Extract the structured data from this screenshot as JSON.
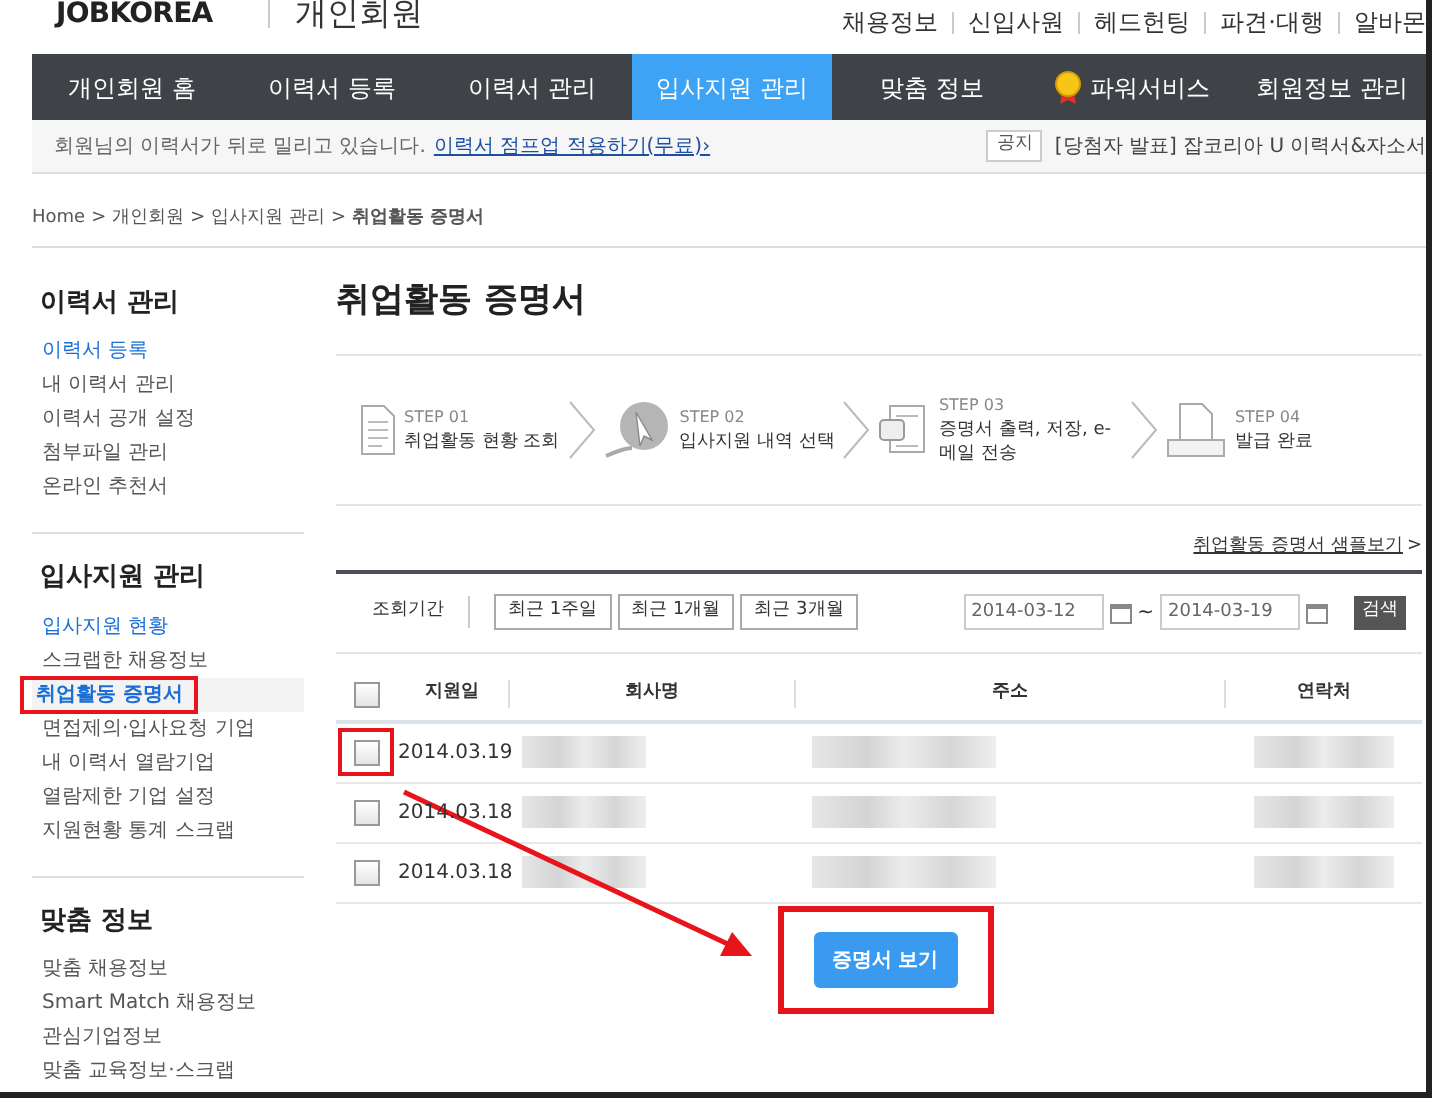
{
  "header": {
    "logo": "JOBKOREA",
    "section": "개인회원",
    "links": [
      "채용정보",
      "신입사원",
      "헤드헌팅",
      "파견·대행",
      "알바몬"
    ]
  },
  "nav": [
    {
      "label": "개인회원 홈",
      "selected": false,
      "kind": "text"
    },
    {
      "label": "이력서 등록",
      "selected": false,
      "kind": "text"
    },
    {
      "label": "이력서 관리",
      "selected": false,
      "kind": "text"
    },
    {
      "label": "입사지원 관리",
      "selected": true,
      "kind": "text"
    },
    {
      "label": "맞춤 정보",
      "selected": false,
      "kind": "text"
    },
    {
      "label": "파워서비스",
      "selected": false,
      "kind": "medal"
    },
    {
      "label": "회원정보 관리",
      "selected": false,
      "kind": "text"
    }
  ],
  "notice": {
    "message": "회원님의 이력서가 뒤로 밀리고 있습니다.",
    "link": "이력서 점프업 적용하기(무료)›",
    "tag": "공지",
    "headline": "[당첨자 발표] 잡코리아 U 이력서&자소서"
  },
  "breadcrumb": {
    "items": [
      "Home",
      "개인회원",
      "입사지원 관리",
      "취업활동 증명서"
    ],
    "separator": ">"
  },
  "sidebar": [
    {
      "title": "이력서 관리",
      "items": [
        {
          "label": "이력서 등록",
          "selected": false,
          "highlighted": true,
          "annotated": false
        },
        {
          "label": "내 이력서 관리",
          "selected": false,
          "highlighted": false,
          "annotated": false
        },
        {
          "label": "이력서 공개 설정",
          "selected": false,
          "highlighted": false,
          "annotated": false
        },
        {
          "label": "첨부파일 관리",
          "selected": false,
          "highlighted": false,
          "annotated": false
        },
        {
          "label": "온라인 추천서",
          "selected": false,
          "highlighted": false,
          "annotated": false
        }
      ]
    },
    {
      "title": "입사지원 관리",
      "items": [
        {
          "label": "입사지원 현황",
          "selected": false,
          "highlighted": true,
          "annotated": false
        },
        {
          "label": "스크랩한 채용정보",
          "selected": false,
          "highlighted": false,
          "annotated": false
        },
        {
          "label": "취업활동 증명서",
          "selected": true,
          "highlighted": true,
          "annotated": true
        },
        {
          "label": "면접제의·입사요청 기업",
          "selected": false,
          "highlighted": false,
          "annotated": false
        },
        {
          "label": "내 이력서 열람기업",
          "selected": false,
          "highlighted": false,
          "annotated": false
        },
        {
          "label": "열람제한 기업 설정",
          "selected": false,
          "highlighted": false,
          "annotated": false
        },
        {
          "label": "지원현황 통계 스크랩",
          "selected": false,
          "highlighted": false,
          "annotated": false
        }
      ]
    },
    {
      "title": "맞춤 정보",
      "items": [
        {
          "label": "맞춤 채용정보",
          "selected": false,
          "highlighted": false,
          "annotated": false
        },
        {
          "label": "Smart Match 채용정보",
          "selected": false,
          "highlighted": false,
          "annotated": false
        },
        {
          "label": "관심기업정보",
          "selected": false,
          "highlighted": false,
          "annotated": false
        },
        {
          "label": "맞춤 교육정보·스크랩",
          "selected": false,
          "highlighted": false,
          "annotated": false
        }
      ]
    }
  ],
  "page_title": "취업활동 증명서",
  "steps": [
    {
      "kind": "document",
      "step": "STEP 01",
      "label": "취업활동 현황 조회"
    },
    {
      "kind": "cursor",
      "step": "STEP 02",
      "label": "입사지원 내역 선택"
    },
    {
      "kind": "print",
      "step": "STEP 03",
      "label": "증명서 출력, 저장, e-메일 전송"
    },
    {
      "kind": "issue",
      "step": "STEP 04",
      "label": "발급 완료"
    }
  ],
  "sample_link": "취업활동 증명서 샘플보기",
  "sample_link_arrow": ">",
  "filter": {
    "label": "조회기간",
    "presets": [
      "최근 1주일",
      "최근 1개월",
      "최근 3개월"
    ],
    "from": "2014-03-12",
    "separator": "~",
    "to": "2014-03-19",
    "search": "검색"
  },
  "table": {
    "select_all_checked": false,
    "columns": [
      "지원일",
      "회사명",
      "주소",
      "연락처"
    ],
    "rows": [
      {
        "checked": false,
        "annotated": true,
        "date": "2014.03.19"
      },
      {
        "checked": false,
        "annotated": false,
        "date": "2014.03.18"
      },
      {
        "checked": false,
        "annotated": false,
        "date": "2014.03.18"
      }
    ]
  },
  "view_button": {
    "label": "증명서 보기",
    "annotated": true
  }
}
